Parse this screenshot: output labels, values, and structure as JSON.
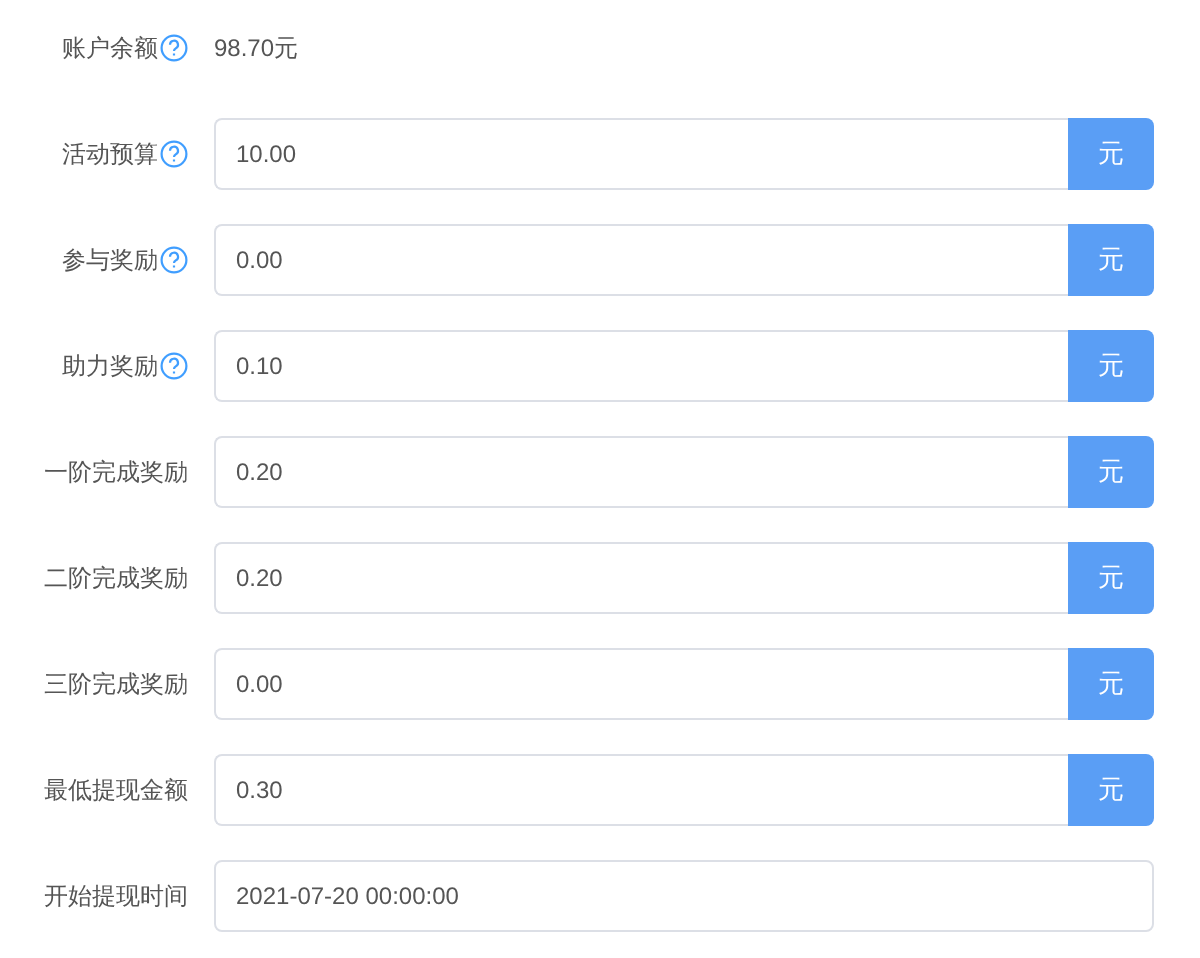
{
  "balance": {
    "label": "账户余额",
    "help": true,
    "value": "98.70元"
  },
  "fields": [
    {
      "label": "活动预算",
      "help": true,
      "value": "10.00",
      "unit": "元"
    },
    {
      "label": "参与奖励",
      "help": true,
      "value": "0.00",
      "unit": "元"
    },
    {
      "label": "助力奖励",
      "help": true,
      "value": "0.10",
      "unit": "元"
    },
    {
      "label": "一阶完成奖励",
      "help": false,
      "value": "0.20",
      "unit": "元"
    },
    {
      "label": "二阶完成奖励",
      "help": false,
      "value": "0.20",
      "unit": "元"
    },
    {
      "label": "三阶完成奖励",
      "help": false,
      "value": "0.00",
      "unit": "元"
    },
    {
      "label": "最低提现金额",
      "help": false,
      "value": "0.30",
      "unit": "元"
    },
    {
      "label": "开始提现时间",
      "help": false,
      "value": "2021-07-20 00:00:00"
    }
  ]
}
